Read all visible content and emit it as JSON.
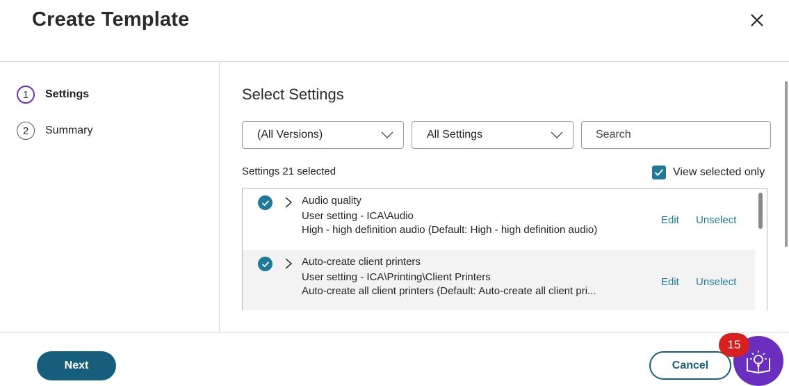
{
  "dialog": {
    "title": "Create Template",
    "close_icon": "close-icon"
  },
  "steps": [
    {
      "number": "1",
      "label": "Settings",
      "active": true
    },
    {
      "number": "2",
      "label": "Summary",
      "active": false
    }
  ],
  "main": {
    "section_title": "Select Settings",
    "filters": {
      "version_selected": "(All Versions)",
      "category_selected": "All Settings",
      "search_placeholder": "Search"
    },
    "count_label": "Settings",
    "count_value": "21 selected",
    "view_selected_only": {
      "label": "View selected only",
      "checked": true
    },
    "settings": [
      {
        "name": "Audio quality",
        "type_path": "User setting - ICA\\Audio",
        "value": "High - high definition audio (Default: High - high definition audio)",
        "edit_label": "Edit",
        "unselect_label": "Unselect",
        "selected": true
      },
      {
        "name": "Auto-create client printers",
        "type_path": "User setting - ICA\\Printing\\Client Printers",
        "value": "Auto-create all client printers (Default: Auto-create all client pri...",
        "edit_label": "Edit",
        "unselect_label": "Unselect",
        "selected": true
      }
    ]
  },
  "footer": {
    "next_label": "Next",
    "cancel_label": "Cancel"
  },
  "help": {
    "badge_count": "15",
    "icon": "lightbulb-book-icon"
  },
  "colors": {
    "accent": "#1f7a9a",
    "primary_button": "#165f7c",
    "step_active": "#6a2fbf",
    "badge": "#d8201f"
  }
}
